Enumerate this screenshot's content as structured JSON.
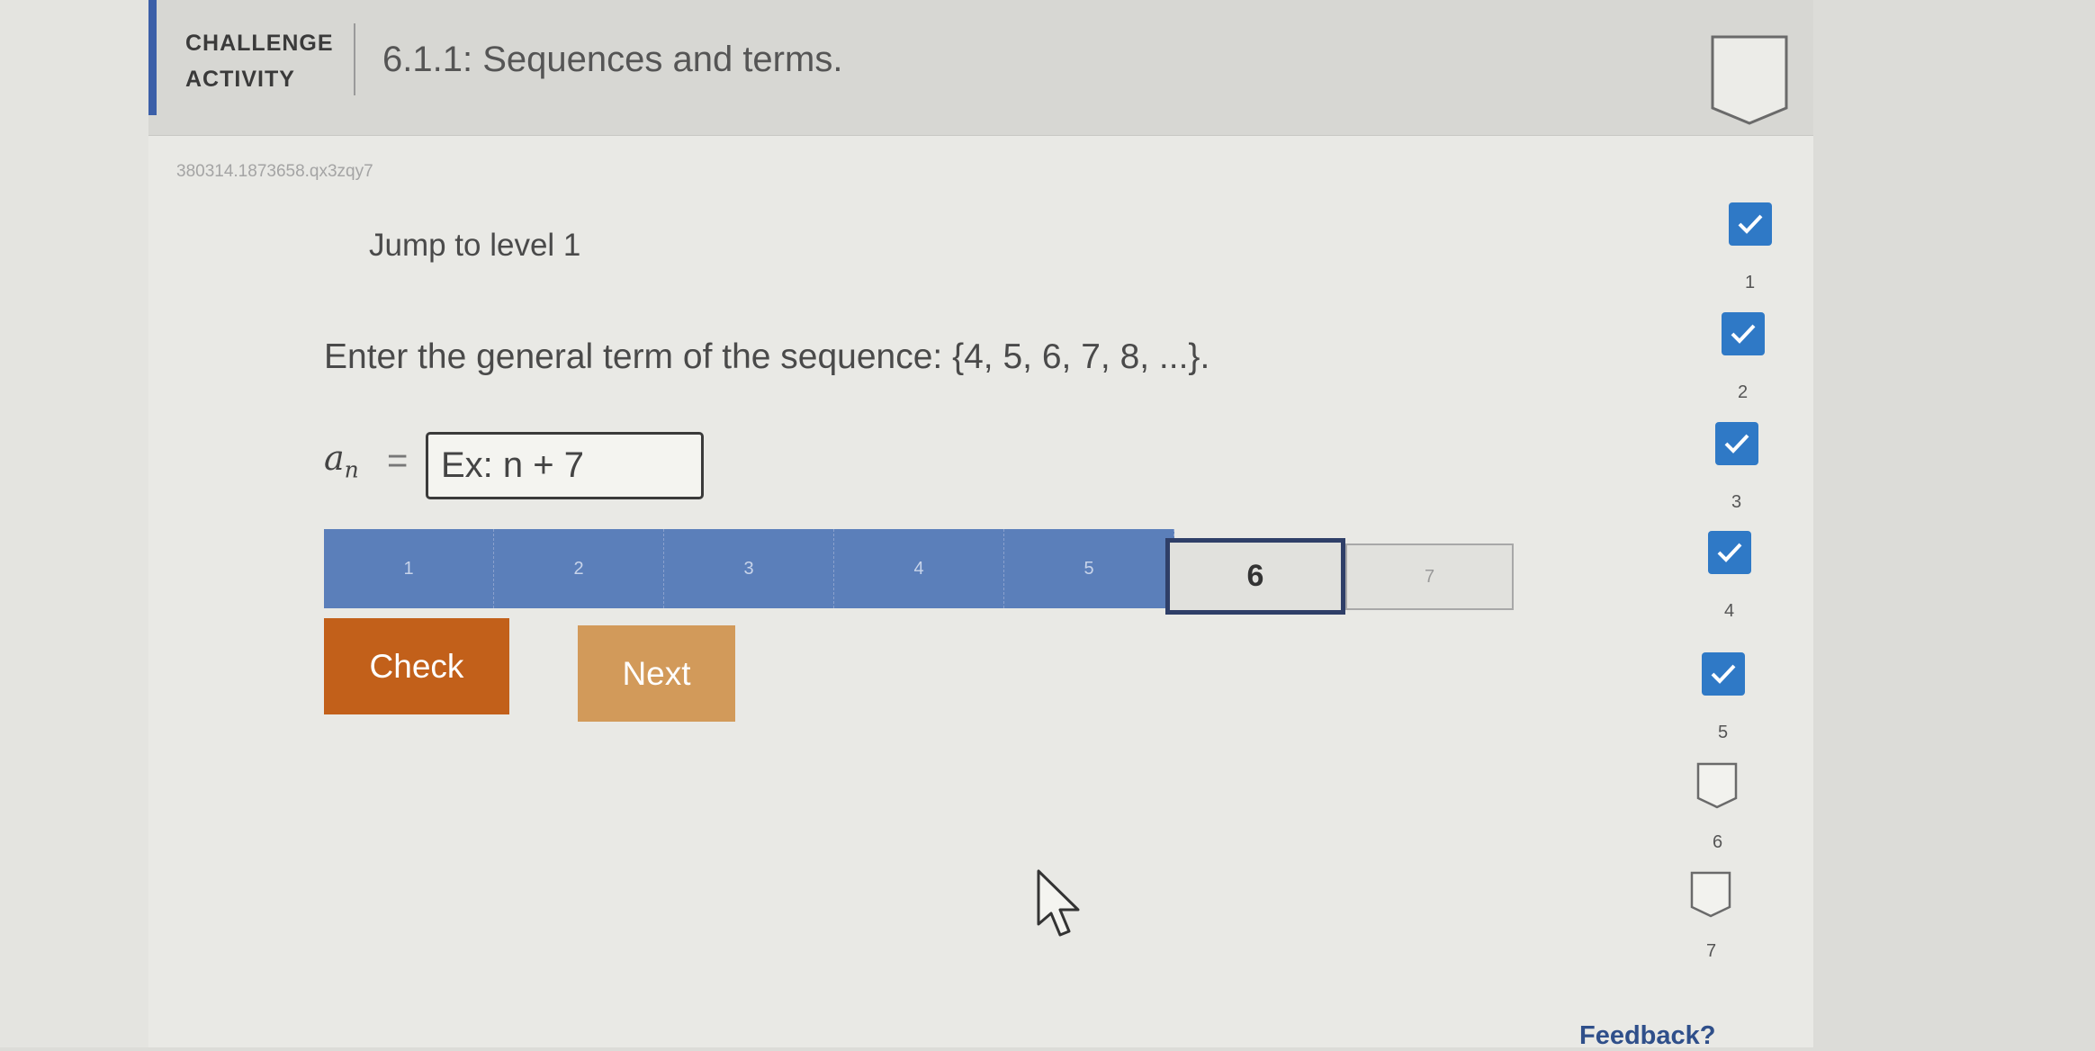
{
  "header": {
    "challenge_line1": "CHALLENGE",
    "challenge_line2": "ACTIVITY",
    "title": "6.1.1: Sequences and terms.",
    "badge_icon": "shield-badge-icon"
  },
  "activity": {
    "code": "380314.1873658.qx3zqy7",
    "jump_label": "Jump to level 1",
    "prompt": "Enter the general term of the sequence: {4, 5, 6, 7, 8, ...}.",
    "math_var": "a",
    "math_sub": "n",
    "equals": "=",
    "input_placeholder": "Ex: n + 7",
    "input_value": ""
  },
  "levels": {
    "segments": [
      {
        "label": "1",
        "state": "done"
      },
      {
        "label": "2",
        "state": "done"
      },
      {
        "label": "3",
        "state": "done"
      },
      {
        "label": "4",
        "state": "done"
      },
      {
        "label": "5",
        "state": "done"
      },
      {
        "label": "6",
        "state": "current"
      },
      {
        "label": "7",
        "state": "pending"
      }
    ]
  },
  "buttons": {
    "check": "Check",
    "next": "Next"
  },
  "progress": {
    "items": [
      {
        "label": "1",
        "completed": true
      },
      {
        "label": "2",
        "completed": true
      },
      {
        "label": "3",
        "completed": true
      },
      {
        "label": "4",
        "completed": true
      },
      {
        "label": "5",
        "completed": true
      },
      {
        "label": "6",
        "completed": false
      },
      {
        "label": "7",
        "completed": false
      }
    ]
  },
  "footer": {
    "feedback": "Feedback?"
  },
  "colors": {
    "accent": "#3b5fa8",
    "level_done": "#5b7fba",
    "check_button": "#c2601a",
    "next_button": "#d29a5a",
    "progress_check": "#2f79c6"
  }
}
